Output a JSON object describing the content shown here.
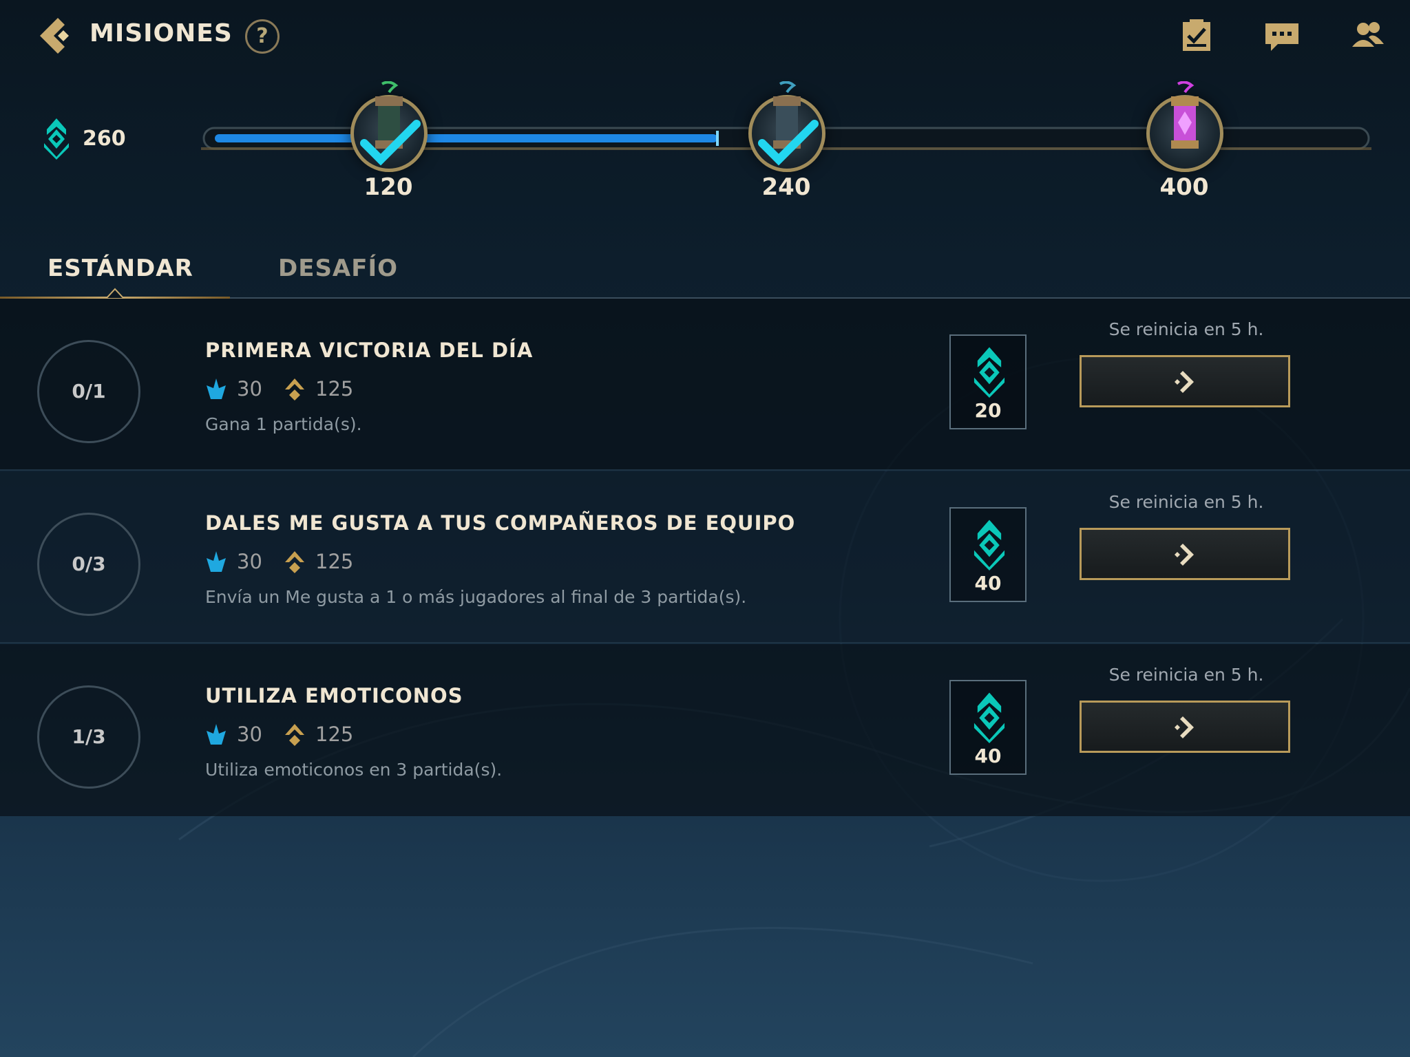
{
  "header": {
    "title": "MISIONES",
    "help_label": "?",
    "icons": [
      "back-arrow-icon",
      "help-icon",
      "checklist-icon",
      "chat-icon",
      "friends-icon"
    ]
  },
  "progress": {
    "points_icon": "mission-token-icon",
    "points": "260",
    "fill_fraction": 0.44,
    "milestones": [
      {
        "label": "120",
        "completed": true,
        "icon": "green-capsule-icon"
      },
      {
        "label": "240",
        "completed": true,
        "icon": "blue-capsule-icon"
      },
      {
        "label": "400",
        "completed": false,
        "icon": "purple-capsule-icon"
      }
    ]
  },
  "tabs": [
    {
      "label": "ESTÁNDAR",
      "active": true
    },
    {
      "label": "DESAFÍO",
      "active": false
    }
  ],
  "missions": [
    {
      "progress": "0/1",
      "title": "PRIMERA VICTORIA DEL DÍA",
      "reward_essence": "30",
      "reward_coins": "125",
      "description": "Gana 1 partida(s).",
      "token_reward": "20",
      "reset": "Se reinicia en 5 h."
    },
    {
      "progress": "0/3",
      "title": "DALES ME GUSTA A TUS COMPAÑEROS DE EQUIPO",
      "reward_essence": "30",
      "reward_coins": "125",
      "description": "Envía un Me gusta a 1 o más jugadores al final de 3 partida(s).",
      "token_reward": "40",
      "reset": "Se reinicia en 5 h."
    },
    {
      "progress": "1/3",
      "title": "UTILIZA EMOTICONOS",
      "reward_essence": "30",
      "reward_coins": "125",
      "description": "Utiliza emoticonos en 3 partida(s).",
      "token_reward": "40",
      "reset": "Se reinicia en 5 h."
    }
  ],
  "colors": {
    "gold": "#c8aa6e",
    "teal": "#0ac8b9",
    "blue_fill": "#1e88e5",
    "text_light": "#f0e6d2"
  }
}
